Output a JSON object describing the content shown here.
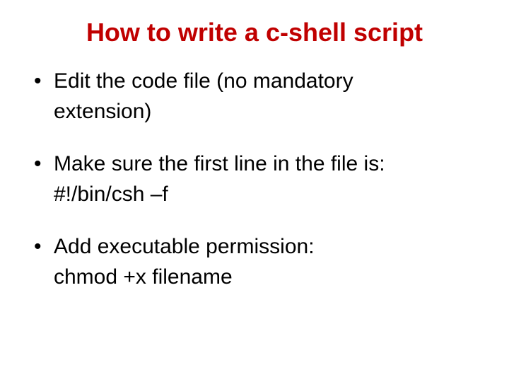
{
  "title": "How to write a c-shell script",
  "bullets": [
    {
      "line1": "Edit the code file (no mandatory",
      "line2": "extension)"
    },
    {
      "line1": "Make sure the first line in the file is:",
      "line2": "#!/bin/csh –f"
    },
    {
      "line1": "Add executable permission:",
      "line2": "chmod +x filename"
    }
  ]
}
